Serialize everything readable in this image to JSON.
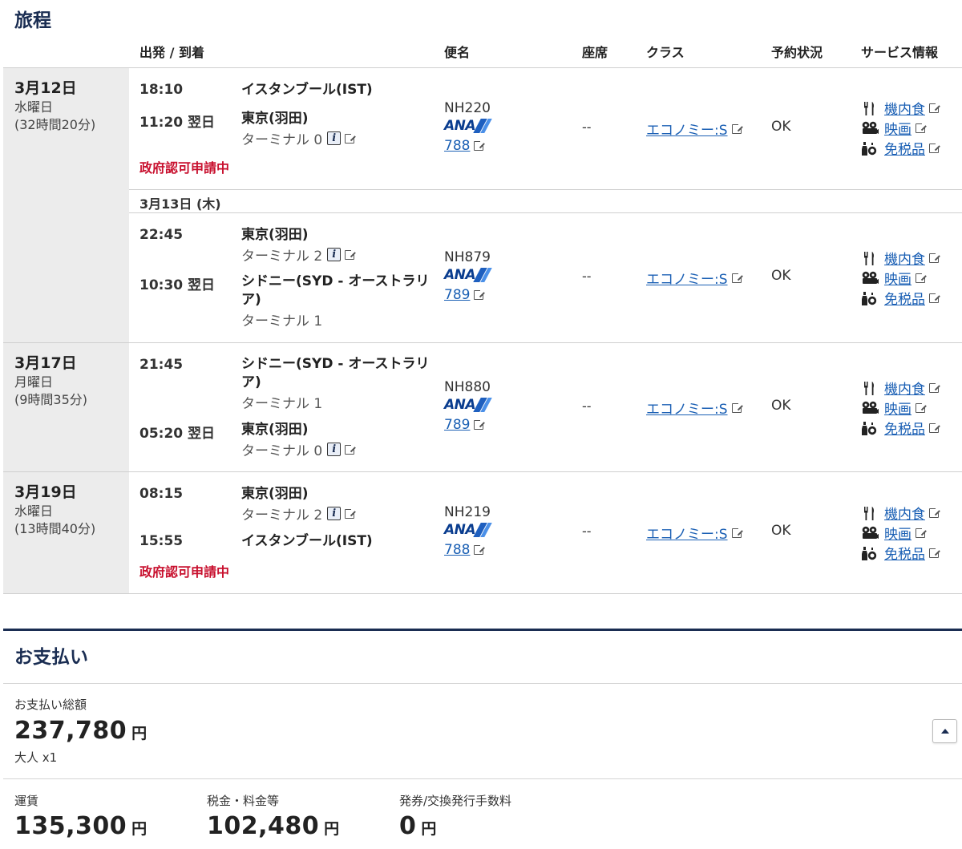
{
  "itinerary": {
    "title": "旅程",
    "columns": {
      "depart_arrive": "出発 / 到着",
      "flight": "便名",
      "seat": "座席",
      "class": "クラス",
      "status": "予約状況",
      "service": "サービス情報"
    },
    "days": [
      {
        "date": "3月12日",
        "weekday": "水曜日",
        "duration": "(32時間20分)"
      },
      {
        "date": "3月17日",
        "weekday": "月曜日",
        "duration": "(9時間35分)"
      },
      {
        "date": "3月19日",
        "weekday": "水曜日",
        "duration": "(13時間40分)"
      }
    ],
    "transit_date_label": "3月13日 (木)",
    "segments": [
      {
        "dep_time": "18:10",
        "dep_airport": "イスタンブール(IST)",
        "dep_terminal": "",
        "arr_time": "11:20 翌日",
        "arr_airport": "東京(羽田)",
        "arr_terminal": "ターミナル 0",
        "flight": "NH220",
        "airline": "ANA",
        "aircraft": "788",
        "seat": "--",
        "class": "エコノミー:S",
        "status": "OK",
        "note": "政府認可申請中"
      },
      {
        "dep_time": "22:45",
        "dep_airport": "東京(羽田)",
        "dep_terminal": "ターミナル 2",
        "arr_time": "10:30 翌日",
        "arr_airport": "シドニー(SYD - オーストラリア)",
        "arr_terminal": "ターミナル 1",
        "flight": "NH879",
        "airline": "ANA",
        "aircraft": "789",
        "seat": "--",
        "class": "エコノミー:S",
        "status": "OK",
        "note": ""
      },
      {
        "dep_time": "21:45",
        "dep_airport": "シドニー(SYD - オーストラリア)",
        "dep_terminal": "ターミナル 1",
        "arr_time": "05:20 翌日",
        "arr_airport": "東京(羽田)",
        "arr_terminal": "ターミナル 0",
        "flight": "NH880",
        "airline": "ANA",
        "aircraft": "789",
        "seat": "--",
        "class": "エコノミー:S",
        "status": "OK",
        "note": ""
      },
      {
        "dep_time": "08:15",
        "dep_airport": "東京(羽田)",
        "dep_terminal": "ターミナル 2",
        "arr_time": "15:55",
        "arr_airport": "イスタンブール(IST)",
        "arr_terminal": "",
        "flight": "NH219",
        "airline": "ANA",
        "aircraft": "788",
        "seat": "--",
        "class": "エコノミー:S",
        "status": "OK",
        "note": "政府認可申請中"
      }
    ],
    "services": {
      "meal": "機内食",
      "movie": "映画",
      "dutyfree": "免税品"
    },
    "icons": [
      "external-link-icon",
      "info-icon",
      "meal-icon",
      "movie-icon",
      "dutyfree-icon",
      "ana-logo"
    ]
  },
  "payment": {
    "title": "お支払い",
    "total_label": "お支払い総額",
    "total_amount": "237,780",
    "currency": "円",
    "passengers": "大人 x1",
    "breakdown": [
      {
        "label": "運賃",
        "amount": "135,300"
      },
      {
        "label": "税金・料金等",
        "amount": "102,480"
      },
      {
        "label": "発券/交換発行手数料",
        "amount": "0"
      }
    ]
  },
  "colors": {
    "navy": "#1a2d52",
    "link": "#1a5fb4",
    "alert": "#c8102e",
    "date_bg": "#ececec"
  }
}
